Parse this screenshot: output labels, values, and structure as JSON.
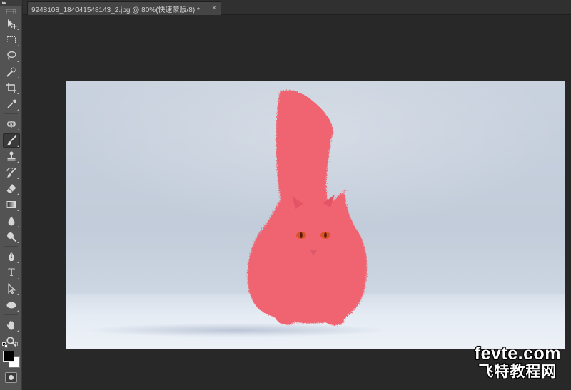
{
  "tab": {
    "title": "9248108_184041548143_2.jpg @ 80%(快速蒙版/8) *",
    "close_glyph": "×"
  },
  "toolbar": {
    "collapse_glyph": "▸▸",
    "active_tool": "brush",
    "tools": [
      {
        "id": "move",
        "icon": "move-icon"
      },
      {
        "id": "marquee",
        "icon": "rectangular-marquee-icon"
      },
      {
        "id": "lasso",
        "icon": "lasso-icon"
      },
      {
        "id": "quick-select",
        "icon": "quick-selection-icon"
      },
      {
        "id": "crop",
        "icon": "crop-icon"
      },
      {
        "id": "eyedropper",
        "icon": "eyedropper-icon"
      },
      {
        "id": "healing",
        "icon": "spot-healing-icon"
      },
      {
        "id": "brush",
        "icon": "brush-icon"
      },
      {
        "id": "stamp",
        "icon": "clone-stamp-icon"
      },
      {
        "id": "history-brush",
        "icon": "history-brush-icon"
      },
      {
        "id": "eraser",
        "icon": "eraser-icon"
      },
      {
        "id": "gradient",
        "icon": "gradient-icon"
      },
      {
        "id": "blur",
        "icon": "blur-drop-icon"
      },
      {
        "id": "dodge",
        "icon": "dodge-icon"
      },
      {
        "id": "pen",
        "icon": "pen-icon"
      },
      {
        "id": "type",
        "icon": "type-icon",
        "glyph": "T"
      },
      {
        "id": "path-select",
        "icon": "path-selection-icon"
      },
      {
        "id": "shape",
        "icon": "ellipse-shape-icon"
      },
      {
        "id": "hand",
        "icon": "hand-icon"
      },
      {
        "id": "zoom",
        "icon": "zoom-icon"
      }
    ],
    "swap_glyph": "↰",
    "foreground_color": "#000000",
    "background_color": "#ffffff"
  },
  "canvas": {
    "zoom_percent": 80,
    "mode": "quick-mask",
    "mask_color": "#f06470"
  },
  "watermark": {
    "line1": "fevte.com",
    "line2": "飞特教程网"
  }
}
